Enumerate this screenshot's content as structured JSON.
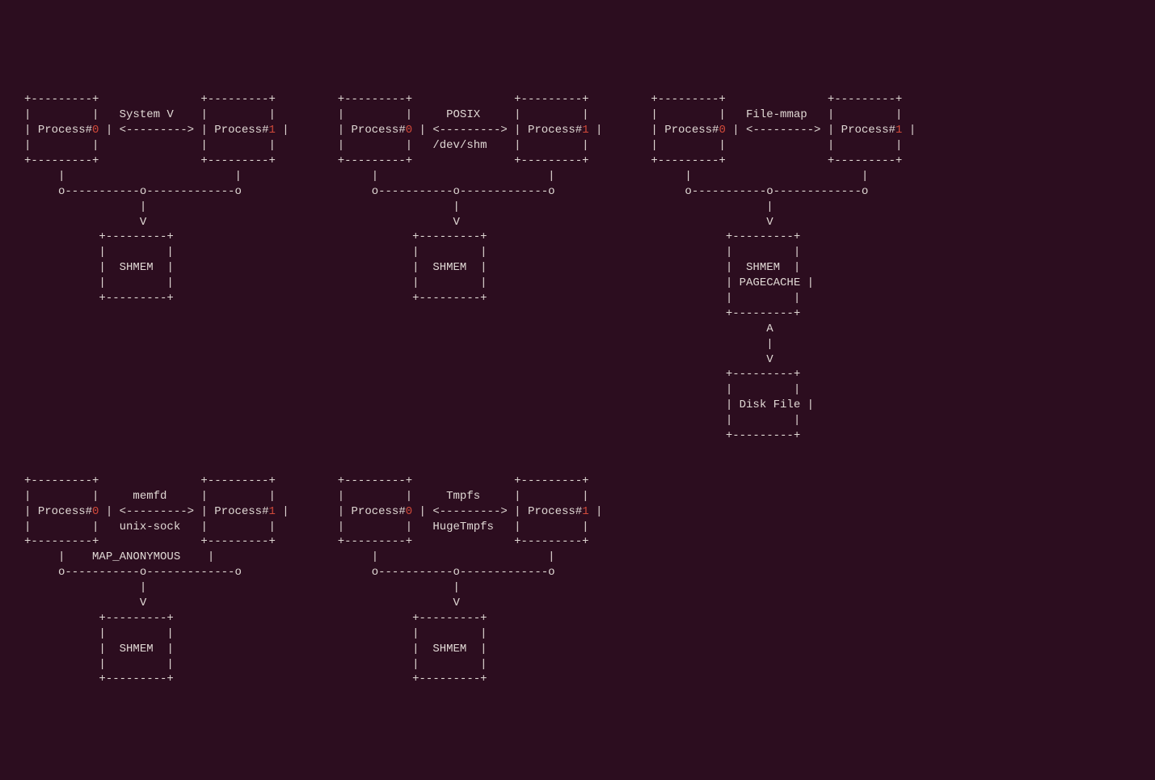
{
  "diagrams": [
    {
      "id": "systemv",
      "label1": "System V",
      "label2": "",
      "label3": "",
      "proc0": "Process#",
      "n0": "0",
      "proc1": "Process#",
      "n1": "1",
      "box": "SHMEM",
      "box2": "",
      "tail": false
    },
    {
      "id": "posix",
      "label1": "POSIX",
      "label2": "/dev/shm",
      "label3": "",
      "proc0": "Process#",
      "n0": "0",
      "proc1": "Process#",
      "n1": "1",
      "box": "SHMEM",
      "box2": "",
      "tail": false
    },
    {
      "id": "filemmap",
      "label1": "File-mmap",
      "label2": "",
      "label3": "",
      "proc0": "Process#",
      "n0": "0",
      "proc1": "Process#",
      "n1": "1",
      "box": "SHMEM",
      "box2": "PAGECACHE",
      "tail": true,
      "tailbox": "Disk File"
    },
    {
      "id": "memfd",
      "label1": "memfd",
      "label2": "unix-sock",
      "label3": "MAP_ANONYMOUS",
      "proc0": "Process#",
      "n0": "0",
      "proc1": "Process#",
      "n1": "1",
      "box": "SHMEM",
      "box2": "",
      "tail": false
    },
    {
      "id": "tmpfs",
      "label1": "Tmpfs",
      "label2": "HugeTmpfs",
      "label3": "",
      "proc0": "Process#",
      "n0": "0",
      "proc1": "Process#",
      "n1": "1",
      "box": "SHMEM",
      "box2": "",
      "tail": false
    }
  ]
}
